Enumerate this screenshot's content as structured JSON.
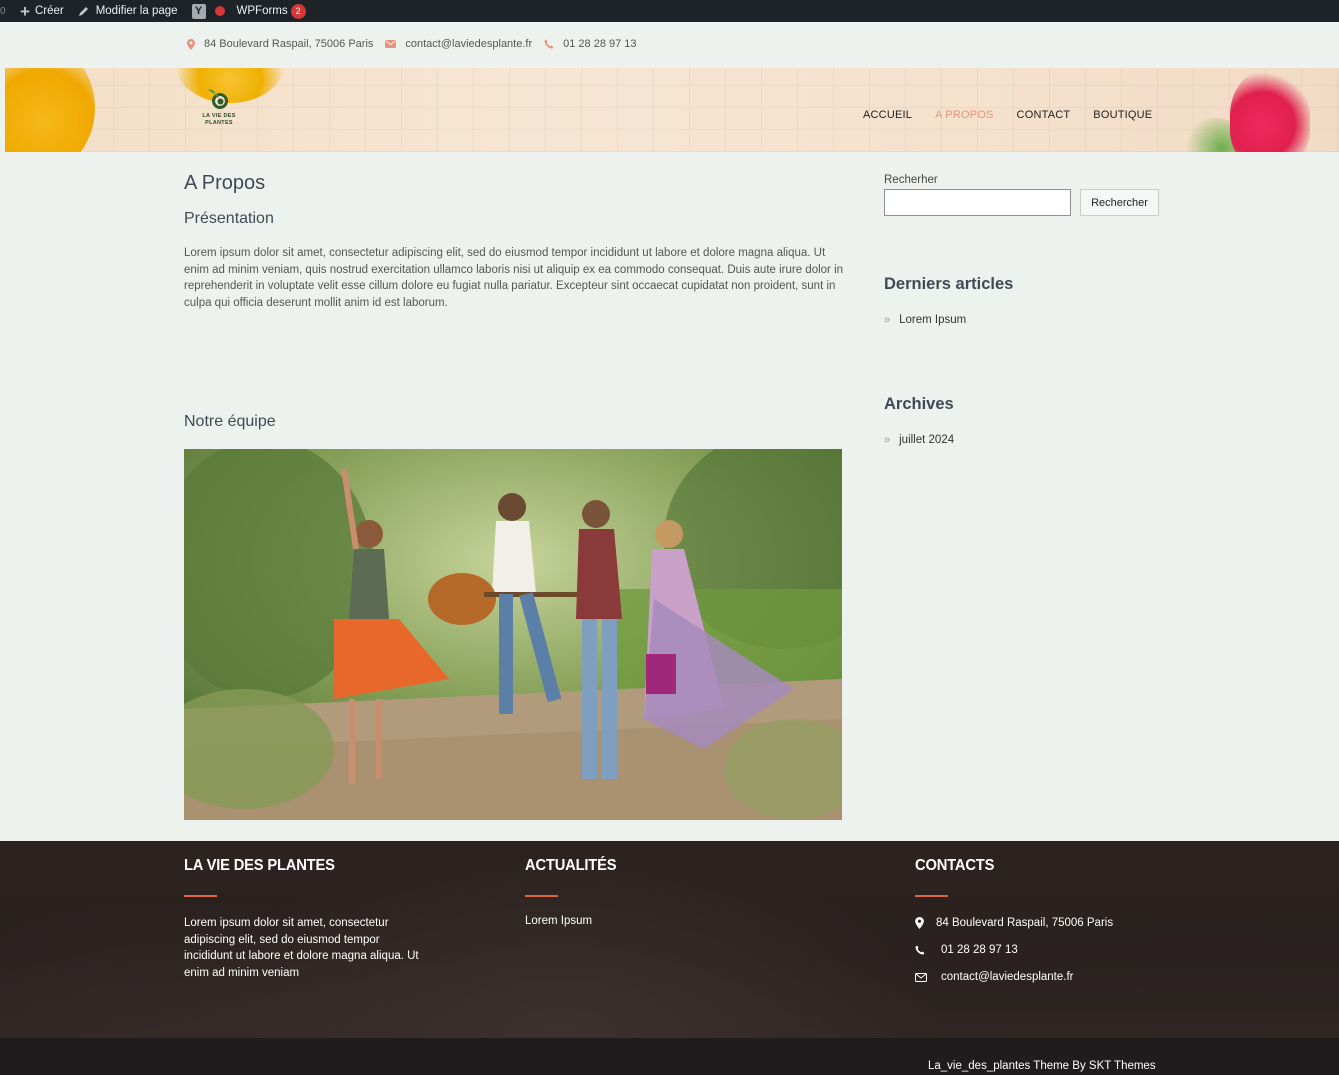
{
  "adminbar": {
    "create_label": "Créer",
    "edit_label": "Modifier la page",
    "yoast_label": "Y",
    "wpforms_label": "WPForms",
    "wpforms_count": "2"
  },
  "topbar": {
    "address": "84 Boulevard Raspail, 75006 Paris",
    "email": "contact@laviedesplante.fr",
    "phone": "01 28 28 97 13"
  },
  "header": {
    "logo_line1": "LA VIE DES",
    "logo_line2": "PLANTES",
    "nav": [
      {
        "label": "ACCUEIL",
        "active": false
      },
      {
        "label": "A PROPOS",
        "active": true
      },
      {
        "label": "CONTACT",
        "active": false
      },
      {
        "label": "BOUTIQUE",
        "active": false
      }
    ],
    "accent_color": "#e8927c"
  },
  "main": {
    "title": "A Propos",
    "presentation_heading": "Présentation",
    "presentation_text": "Lorem ipsum dolor sit amet, consectetur adipiscing elit, sed do eiusmod tempor incididunt ut labore et dolore magna aliqua. Ut enim ad minim veniam, quis nostrud exercitation ullamco laboris nisi ut aliquip ex ea commodo consequat. Duis aute irure dolor in reprehenderit in voluptate velit esse cillum dolore eu fugiat nulla pariatur. Excepteur sint occaecat cupidatat non proident, sunt in culpa qui officia deserunt mollit anim id est laborum.",
    "team_heading": "Notre équipe"
  },
  "sidebar": {
    "search_label": "Recherher",
    "search_value": "",
    "search_button": "Rechercher",
    "recent_heading": "Derniers articles",
    "recent_items": [
      "Lorem Ipsum"
    ],
    "archives_heading": "Archives",
    "archive_items": [
      "juillet 2024"
    ]
  },
  "footer": {
    "col1_title": "LA VIE DES PLANTES",
    "col1_text": "Lorem ipsum dolor sit amet, consectetur adipiscing elit, sed do eiusmod tempor incididunt ut labore et dolore magna aliqua. Ut enim ad minim veniam",
    "col2_title": "ACTUALITÉS",
    "col2_link": "Lorem Ipsum",
    "col3_title": "CONTACTS",
    "address": "84 Boulevard Raspail, 75006 Paris",
    "phone": "01 28 28 97 13",
    "email": "contact@laviedesplante.fr",
    "accent_color": "#e0623f",
    "copyright": "La_vie_des_plantes Theme By SKT Themes"
  }
}
